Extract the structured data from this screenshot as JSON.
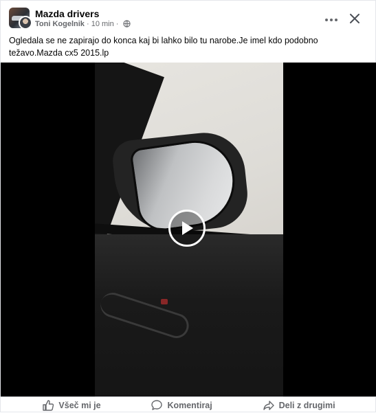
{
  "post": {
    "group_name": "Mazda drivers",
    "poster_name": "Toni Kogelnik",
    "separator": "·",
    "time": "10 min",
    "text": "Ogledala se ne zapirajo do konca kaj bi lahko bilo tu narobe.Je imel kdo podobno težavo.Mazda cx5 2015.lp"
  },
  "icons": {
    "globe": "globe-icon",
    "more": "more-options-icon",
    "close": "close-icon",
    "play": "play-icon",
    "like": "thumbs-up-icon",
    "comment": "comment-icon",
    "share": "share-icon"
  },
  "actions": {
    "like_label": "Všeč mi je",
    "comment_label": "Komentiraj",
    "share_label": "Deli z drugimi"
  },
  "colors": {
    "text_primary": "#050505",
    "text_secondary": "#65676b",
    "video_background": "#000000"
  }
}
